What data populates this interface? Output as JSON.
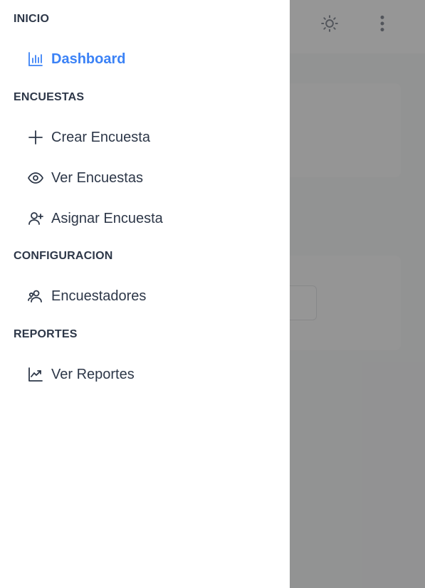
{
  "drawer": {
    "sections": [
      {
        "title": "INICIO",
        "items": [
          {
            "label": "Dashboard",
            "icon": "bar-chart-icon",
            "active": true
          }
        ]
      },
      {
        "title": "ENCUESTAS",
        "items": [
          {
            "label": "Crear Encuesta",
            "icon": "plus-icon"
          },
          {
            "label": "Ver Encuestas",
            "icon": "eye-icon"
          },
          {
            "label": "Asignar Encuesta",
            "icon": "user-plus-icon"
          }
        ]
      },
      {
        "title": "CONFIGURACION",
        "items": [
          {
            "label": "Encuestadores",
            "icon": "users-icon"
          }
        ]
      },
      {
        "title": "REPORTES",
        "items": [
          {
            "label": "Ver Reportes",
            "icon": "trending-up-icon"
          }
        ]
      }
    ]
  },
  "topbar": {
    "icons": [
      "sun-icon",
      "more-vertical-icon"
    ]
  },
  "colors": {
    "accent": "#3b82f6",
    "text": "#2d3748",
    "overlay": "rgba(100,100,100,0.68)"
  }
}
